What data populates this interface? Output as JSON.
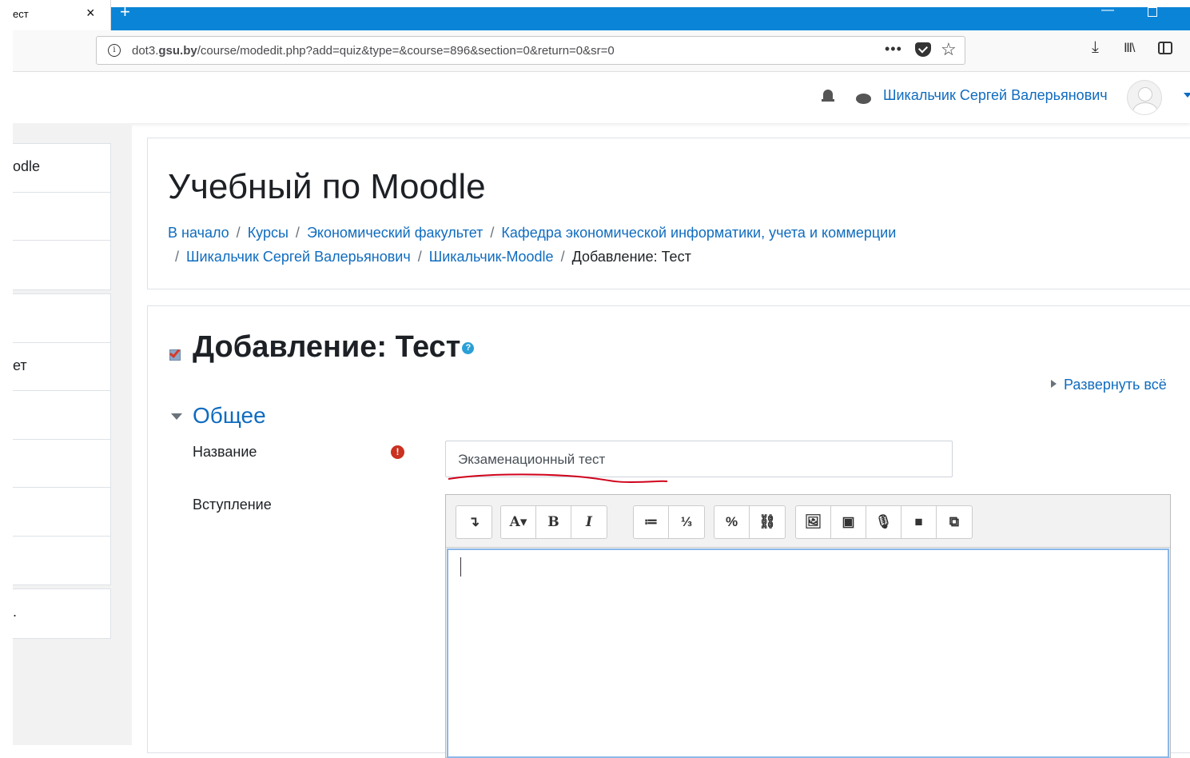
{
  "browser": {
    "tab_title": "ест",
    "tab_close": "×",
    "new_tab": "+",
    "url_host_prefix": "dot3.",
    "url_host": "gsu.by",
    "url_path": "/course/modedit.php?add=quiz&type=&course=896&section=0&return=0&sr=0",
    "more": "•••",
    "star": "☆",
    "download": "⤓",
    "library": "Ⅲ\\"
  },
  "header": {
    "username": "Шикальчик Сергей Валерьянович"
  },
  "drawer": {
    "groups": [
      [
        "odle",
        "",
        ""
      ],
      [
        "",
        "ет",
        "",
        "",
        "",
        ""
      ],
      [
        "."
      ]
    ]
  },
  "course": {
    "title": "Учебный по Moodle",
    "breadcrumbs": [
      "В начало",
      "Курсы",
      "Экономический факультет",
      "Кафедра экономической информатики, учета и коммерции",
      "Шикальчик Сергей Валерьянович",
      "Шикальчик-Moodle",
      "Добавление: Тест"
    ],
    "separator": "/"
  },
  "form": {
    "heading": "Добавление: Тест",
    "help_glyph": "?",
    "expand_all": "Развернуть всё",
    "section": "Общее",
    "name_label": "Название",
    "required_glyph": "!",
    "name_value": "Экзаменационный тест",
    "intro_label": "Вступление"
  },
  "editor": {
    "buttons": [
      "↴",
      "A▾",
      "B",
      "I",
      "≔",
      "⅓",
      "%",
      "⛓",
      "🖼",
      "▣",
      "🎙",
      "■",
      "⧉"
    ]
  },
  "colors": {
    "accent": "#0f6cbf",
    "browser_chrome": "#0a84d6",
    "required": "#ca3120",
    "annotation_underline": "#d0021b"
  }
}
